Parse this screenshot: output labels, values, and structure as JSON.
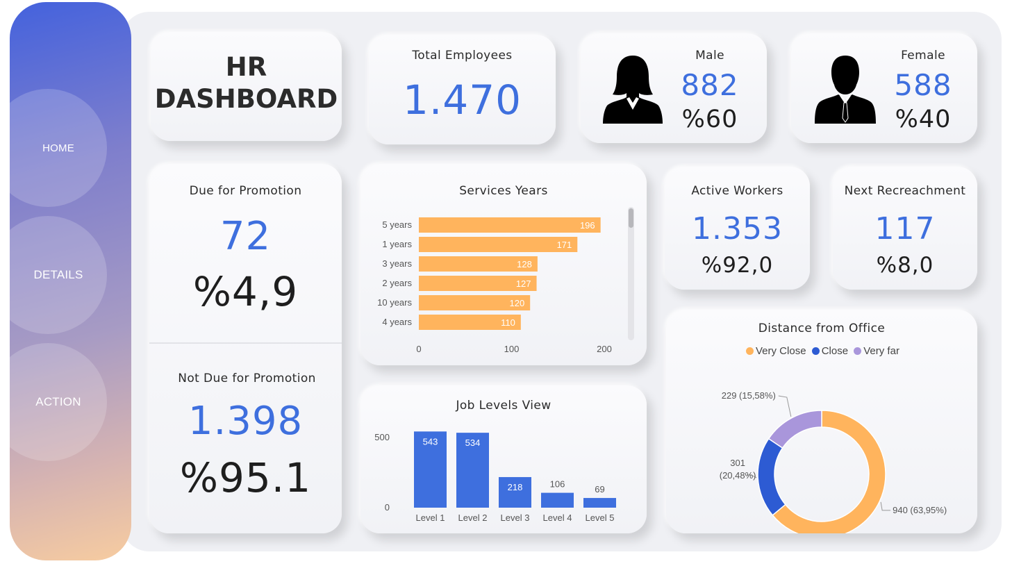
{
  "nav": {
    "home": "HOME",
    "details": "DETAILS",
    "action": "ACTION"
  },
  "title": {
    "line1": "HR",
    "line2": "DASHBOARD"
  },
  "total": {
    "label": "Total Employees",
    "value": "1.470"
  },
  "male": {
    "label": "Male",
    "value": "882",
    "pct": "%60",
    "icon": "female-silhouette-icon"
  },
  "female": {
    "label": "Female",
    "value": "588",
    "pct": "%40",
    "icon": "male-silhouette-icon"
  },
  "promotion": {
    "due_label": "Due for Promotion",
    "due_value": "72",
    "due_pct": "%4,9",
    "not_label": "Not Due for Promotion",
    "not_value": "1.398",
    "not_pct": "%95.1"
  },
  "active": {
    "label": "Active Workers",
    "value": "1.353",
    "pct": "%92,0"
  },
  "recreachment": {
    "label": "Next Recreachment",
    "value": "117",
    "pct": "%8,0"
  },
  "colors": {
    "blue": "#3e6fde",
    "orange": "#ffb45d",
    "purple": "#a996db",
    "dark_blue": "#2d5bd3"
  },
  "chart_data": [
    {
      "type": "bar",
      "orientation": "horizontal",
      "title": "Services Years",
      "categories": [
        "5 years",
        "1 years",
        "3 years",
        "2 years",
        "10 years",
        "4 years"
      ],
      "values": [
        196,
        171,
        128,
        127,
        120,
        110
      ],
      "xlim": [
        0,
        200
      ],
      "xticks": [
        "0",
        "100",
        "200"
      ],
      "color": "#ffb45d",
      "data_labels": true,
      "grid": false
    },
    {
      "type": "bar",
      "title": "Job Levels View",
      "categories": [
        "Level 1",
        "Level 2",
        "Level 3",
        "Level 4",
        "Level 5"
      ],
      "values": [
        543,
        534,
        218,
        106,
        69
      ],
      "ylim": [
        0,
        600
      ],
      "yticks": [
        "0",
        "500"
      ],
      "color": "#3e6fde",
      "data_labels": true,
      "grid": false
    },
    {
      "type": "pie",
      "variant": "donut",
      "title": "Distance from Office",
      "legend_position": "top",
      "slices": [
        {
          "name": "Very Close",
          "value": 940,
          "label": "940 (63,95%)",
          "color": "#ffb45d"
        },
        {
          "name": "Close",
          "value": 301,
          "label_line1": "301",
          "label_line2": "(20,48%)",
          "color": "#2d5bd3"
        },
        {
          "name": "Very far",
          "value": 229,
          "label": "229 (15,58%)",
          "color": "#a996db"
        }
      ]
    }
  ]
}
